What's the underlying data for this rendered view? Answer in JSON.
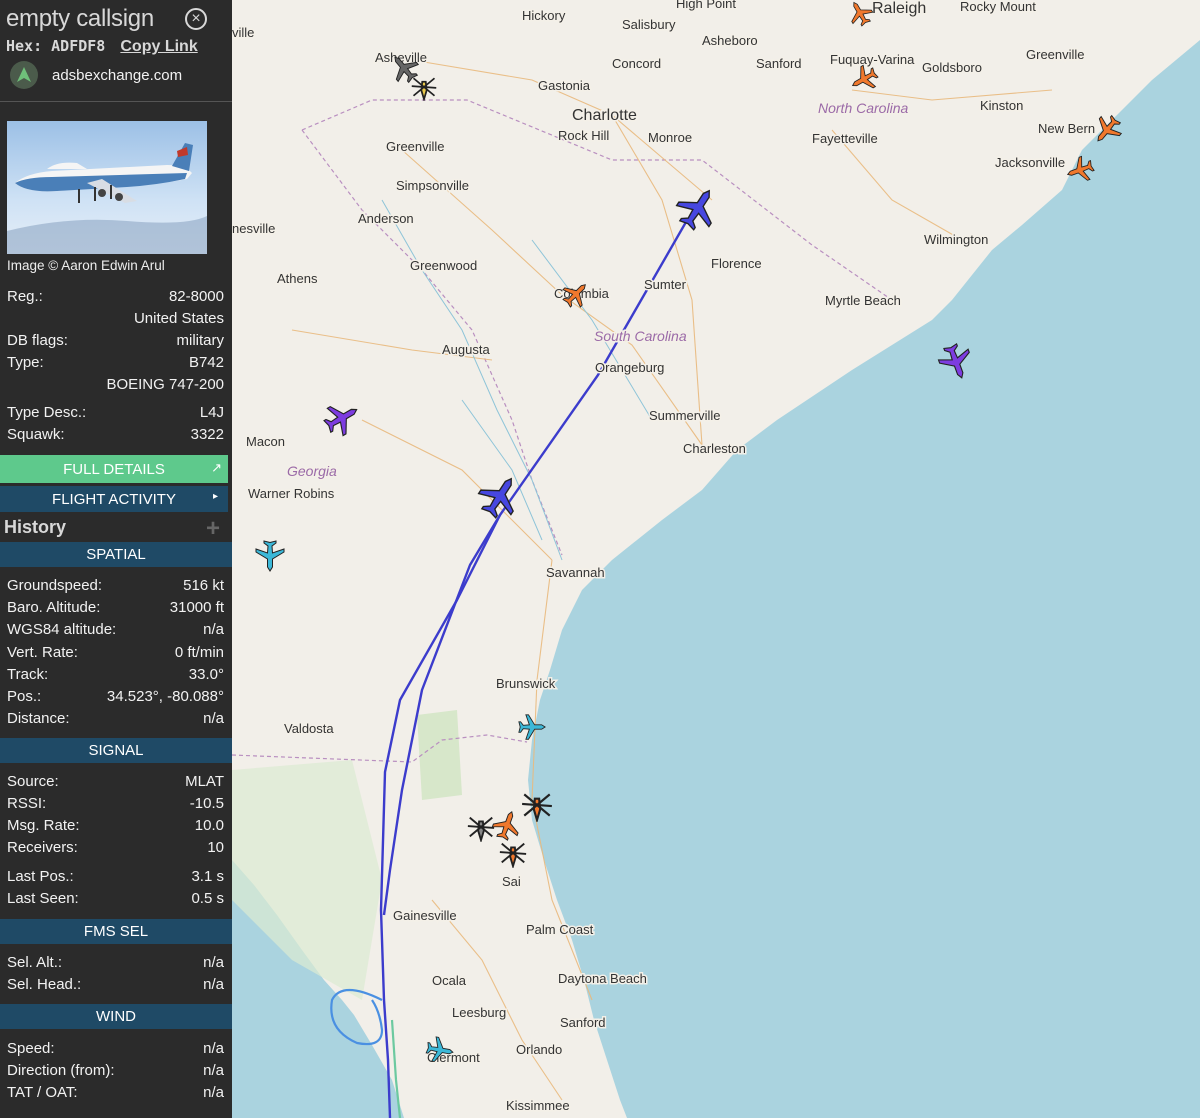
{
  "aircraft": {
    "callsign": "empty callsign",
    "hex_label": "Hex:",
    "hex": "ADFDF8",
    "copy_link": "Copy Link",
    "source_site": "adsbexchange.com",
    "close_glyph": "ⓧ"
  },
  "photo": {
    "credit": "Image © Aaron Edwin Arul"
  },
  "details": [
    {
      "label": "Reg.:",
      "value": "82-8000"
    },
    {
      "label": "",
      "value": "United States"
    },
    {
      "label": "DB flags:",
      "value": "military"
    },
    {
      "label": "Type:",
      "value": "B742"
    },
    {
      "label": "",
      "value": "BOEING 747-200"
    },
    {
      "label": "Type Desc.:",
      "value": "L4J"
    },
    {
      "label": "Squawk:",
      "value": "3322"
    }
  ],
  "buttons": {
    "full_details": "FULL DETAILS",
    "flight_activity": "FLIGHT ACTIVITY",
    "flight_activity_arrow": "▸",
    "external_glyph": "↗"
  },
  "history": {
    "title": "History",
    "plus": "+"
  },
  "sections": {
    "spatial": "SPATIAL",
    "signal": "SIGNAL",
    "fms": "FMS SEL",
    "wind": "WIND"
  },
  "spatial": [
    {
      "label": "Groundspeed:",
      "value": "516 kt"
    },
    {
      "label": "Baro. Altitude:",
      "value": "31000 ft"
    },
    {
      "label": "WGS84 altitude:",
      "value": "n/a"
    },
    {
      "label": "Vert. Rate:",
      "value": "0 ft/min"
    },
    {
      "label": "Track:",
      "value": "33.0°"
    },
    {
      "label": "Pos.:",
      "value": "34.523°, -80.088°"
    },
    {
      "label": "Distance:",
      "value": "n/a"
    }
  ],
  "signal": [
    {
      "label": "Source:",
      "value": "MLAT"
    },
    {
      "label": "RSSI:",
      "value": "-10.5"
    },
    {
      "label": "Msg. Rate:",
      "value": "10.0"
    },
    {
      "label": "Receivers:",
      "value": "10"
    },
    {
      "label": "Last Pos.:",
      "value": "3.1 s"
    },
    {
      "label": "Last Seen:",
      "value": "0.5 s"
    }
  ],
  "fms": [
    {
      "label": "Sel. Alt.:",
      "value": "n/a"
    },
    {
      "label": "Sel. Head.:",
      "value": "n/a"
    }
  ],
  "wind": [
    {
      "label": "Speed:",
      "value": "n/a"
    },
    {
      "label": "Direction (from):",
      "value": "n/a"
    },
    {
      "label": "TAT / OAT:",
      "value": "n/a"
    }
  ],
  "map": {
    "cities": [
      "Hickory",
      "High Point",
      "Raleigh",
      "Rocky Mount",
      "Salisbury",
      "Asheboro",
      "Asheville",
      "Concord",
      "Sanford",
      "Fuquay-Varina",
      "Goldsboro",
      "Greenville",
      "Gastonia",
      "Charlotte",
      "Rock Hill",
      "Monroe",
      "Kinston",
      "New Bern",
      "Fayetteville",
      "Jacksonville",
      "Greenville",
      "Simpsonville",
      "Anderson",
      "Wilmington",
      "Greenwood",
      "Florence",
      "Athens",
      "Columbia",
      "Sumter",
      "Myrtle Beach",
      "Augusta",
      "Orangeburg",
      "Summerville",
      "Charleston",
      "Macon",
      "Warner Robins",
      "Savannah",
      "Brunswick",
      "Valdosta",
      "Gainesville",
      "Palm Coast",
      "Ocala",
      "Daytona Beach",
      "Leesburg",
      "Sanford",
      "Orlando",
      "Clermont",
      "Kissimmee",
      "nesville",
      "ville",
      "Sai"
    ],
    "states": [
      "North Carolina",
      "South Carolina",
      "Georgia"
    ],
    "colors": {
      "sea": "#aad3df",
      "land": "#f2efe9",
      "track": "#3c3ccc",
      "selected_plane": "#4747e0",
      "mil_plane": "#7d3ce0",
      "orange_plane": "#f0782d",
      "cyan_plane": "#3cb8d8",
      "gray_plane": "#666666",
      "yellow_plane": "#e8c84a"
    }
  }
}
